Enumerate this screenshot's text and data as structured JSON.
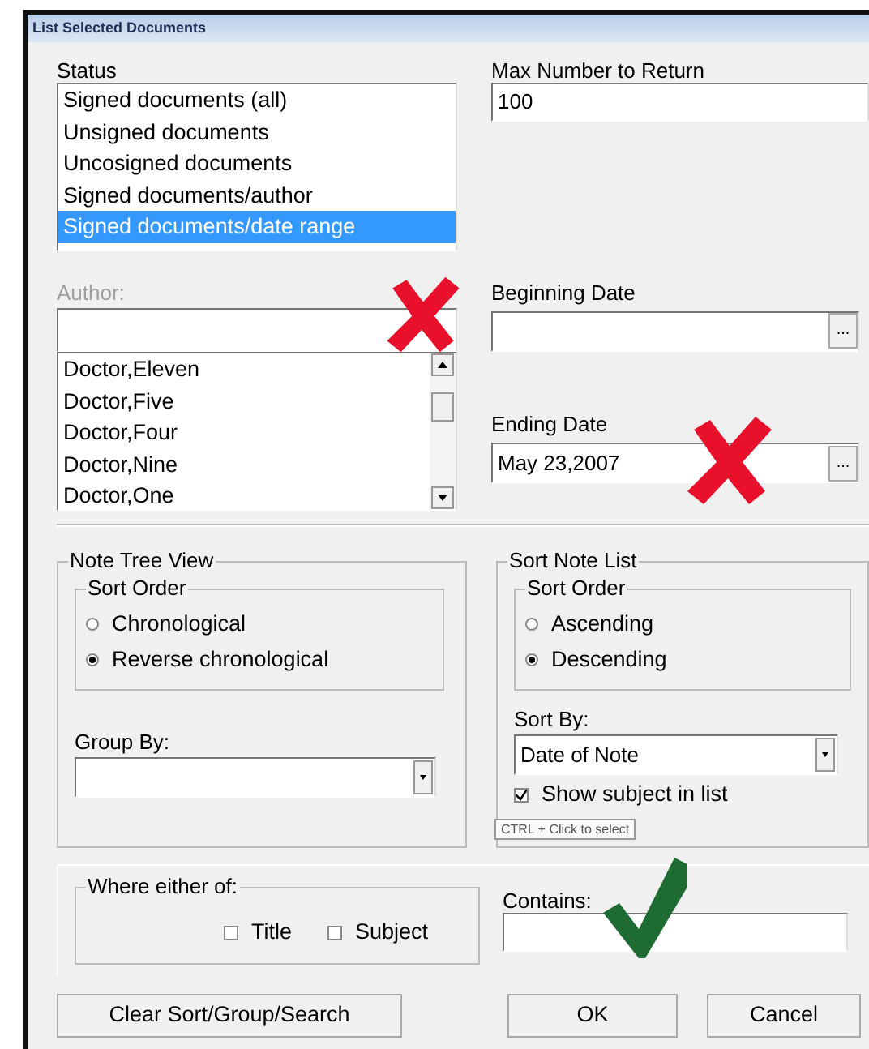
{
  "window": {
    "title": "List Selected Documents"
  },
  "status": {
    "label": "Status",
    "items": [
      {
        "text": "Signed documents (all)",
        "selected": false
      },
      {
        "text": "Unsigned documents",
        "selected": false
      },
      {
        "text": "Uncosigned documents",
        "selected": false
      },
      {
        "text": "Signed documents/author",
        "selected": false
      },
      {
        "text": "Signed documents/date range",
        "selected": true
      }
    ]
  },
  "max_number": {
    "label": "Max Number to Return",
    "value": "100"
  },
  "author": {
    "label": "Author:",
    "disabled": true,
    "items": [
      "Doctor,Eleven",
      "Doctor,Five",
      "Doctor,Four",
      "Doctor,Nine",
      "Doctor,One"
    ]
  },
  "beginning_date": {
    "label": "Beginning Date",
    "button": "..."
  },
  "ending_date": {
    "label": "Ending Date",
    "value": "May 23,2007",
    "button": "..."
  },
  "note_tree_view": {
    "title": "Note Tree View",
    "sort_order": {
      "title": "Sort Order",
      "options": [
        {
          "label": "Chronological",
          "selected": false
        },
        {
          "label": "Reverse chronological",
          "selected": true
        }
      ]
    },
    "group_by": {
      "label": "Group By:"
    }
  },
  "sort_note_list": {
    "title": "Sort Note List",
    "sort_order": {
      "title": "Sort Order",
      "options": [
        {
          "label": "Ascending",
          "selected": false
        },
        {
          "label": "Descending",
          "selected": true
        }
      ]
    },
    "sort_by": {
      "label": "Sort By:",
      "value": "Date of Note"
    },
    "show_subject": {
      "label": "Show subject in list",
      "checked": true
    }
  },
  "tooltip": "CTRL + Click to select",
  "search": {
    "title": "Where either of:",
    "options": [
      {
        "label": "Title",
        "checked": false
      },
      {
        "label": "Subject",
        "checked": false
      }
    ],
    "contains_label": "Contains:"
  },
  "buttons": [
    "Clear Sort/Group/Search",
    "OK",
    "Cancel"
  ]
}
